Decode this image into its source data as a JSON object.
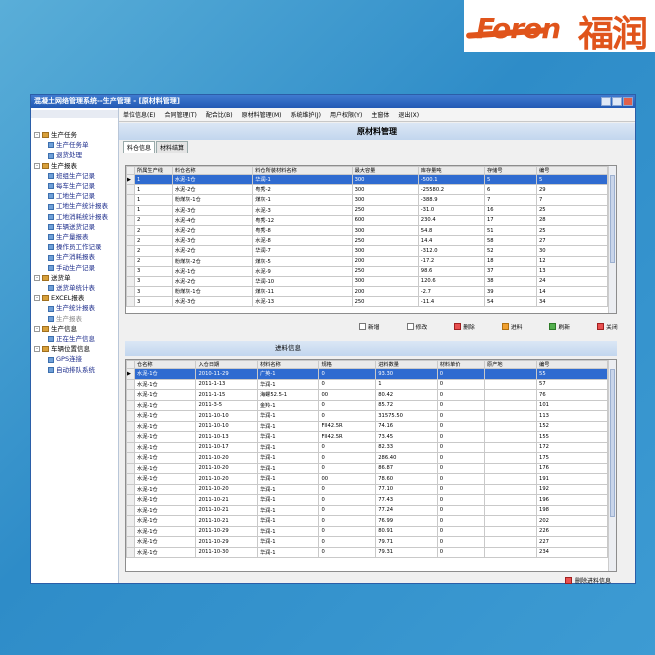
{
  "logo": {
    "en": "Foron",
    "cn": "福润"
  },
  "window": {
    "title": "混凝土网络管理系统--生产管理 - [原材料管理]"
  },
  "menu": [
    "单位信息(E)",
    "合同管理(T)",
    "配合比(B)",
    "原材料管理(M)",
    "系统维护(J)",
    "用户权限(Y)",
    "主窗体",
    "退出(X)"
  ],
  "sidebar": [
    {
      "label": "生产任务",
      "items": [
        {
          "label": "生产任务单"
        },
        {
          "label": "退货处理"
        }
      ]
    },
    {
      "label": "生产报表",
      "items": [
        {
          "label": "班组生产记录"
        },
        {
          "label": "每车生产记录"
        },
        {
          "label": "工地生产记录"
        },
        {
          "label": "工地生产统计报表"
        },
        {
          "label": "工地消耗统计报表"
        },
        {
          "label": "车辆送货记录"
        },
        {
          "label": "生产量报表"
        },
        {
          "label": "操作员工作记录"
        },
        {
          "label": "生产消耗报表"
        },
        {
          "label": "手动生产记录"
        }
      ]
    },
    {
      "label": "送货单",
      "items": [
        {
          "label": "送货单统计表"
        }
      ]
    },
    {
      "label": "EXCEL报表",
      "items": [
        {
          "label": "生产统计报表"
        },
        {
          "label": "生产报表"
        }
      ]
    },
    {
      "label": "生产信息",
      "items": [
        {
          "label": "正在生产信息"
        }
      ]
    },
    {
      "label": "车辆位置信息",
      "items": [
        {
          "label": "GPS连接"
        },
        {
          "label": "自动排队系统"
        }
      ]
    }
  ],
  "page_title": "原材料管理",
  "tabs": [
    "料仓信息",
    "材料结算"
  ],
  "bins": {
    "columns": [
      "所属生产线",
      "料仓名称",
      "料仓所装材料名称",
      "最大容量",
      "库存量吨",
      "存储号",
      "编号"
    ],
    "rows": [
      [
        "1",
        "水泥-1仓",
        "华润-1",
        "300",
        "-500.1",
        "5",
        "5"
      ],
      [
        "1",
        "水泥-2仓",
        "粤秀-2",
        "300",
        "-25580.2",
        "6",
        "29"
      ],
      [
        "1",
        "粉煤灰-1仓",
        "煤灰-1",
        "300",
        "-388.9",
        "7",
        "7"
      ],
      [
        "1",
        "水泥-3仓",
        "水泥-3",
        "250",
        "-31.0",
        "16",
        "25"
      ],
      [
        "2",
        "水泥-4仓",
        "粤秀-12",
        "600",
        "230.4",
        "17",
        "28"
      ],
      [
        "2",
        "水泥-2仓",
        "粤秀-8",
        "300",
        "54.8",
        "51",
        "25"
      ],
      [
        "2",
        "水泥-3仓",
        "水泥-8",
        "250",
        "14.4",
        "58",
        "27"
      ],
      [
        "2",
        "水泥-2仓",
        "华润-7",
        "300",
        "-312.0",
        "52",
        "30"
      ],
      [
        "2",
        "粉煤灰-2仓",
        "煤灰-5",
        "200",
        "-17.2",
        "18",
        "12"
      ],
      [
        "3",
        "水泥-1仓",
        "水泥-9",
        "250",
        "98.6",
        "37",
        "13"
      ],
      [
        "3",
        "水泥-2仓",
        "华润-10",
        "300",
        "120.6",
        "38",
        "24"
      ],
      [
        "3",
        "粉煤灰-1仓",
        "煤灰-11",
        "200",
        "-2.7",
        "39",
        "14"
      ],
      [
        "3",
        "水泥-3仓",
        "水泥-13",
        "250",
        "-11.4",
        "54",
        "34"
      ]
    ]
  },
  "toolbar": [
    "新增",
    "修改",
    "删除",
    "进料",
    "刷新",
    "关闭"
  ],
  "recv": {
    "header": "进料信息",
    "columns": [
      "仓名称",
      "入仓日期",
      "材料名称",
      "规格",
      "进料数量",
      "材料单价",
      "原产地",
      "编号"
    ],
    "rows": [
      [
        "水泥-1仓",
        "2010-11-29",
        "广英-1",
        "0",
        "93.30",
        "0",
        "",
        "55"
      ],
      [
        "水泥-1仓",
        "2011-1-13",
        "华润-1",
        "0",
        "1",
        "0",
        "",
        "57"
      ],
      [
        "水泥-1仓",
        "2011-1-15",
        "海螺52.5-1",
        "00",
        "80.42",
        "0",
        "",
        "76"
      ],
      [
        "水泥-1仓",
        "2011-3-5",
        "金羚-1",
        "0",
        "85.72",
        "0",
        "",
        "101"
      ],
      [
        "水泥-1仓",
        "2011-10-10",
        "华润-1",
        "0",
        "31575.50",
        "0",
        "",
        "113"
      ],
      [
        "水泥-1仓",
        "2011-10-10",
        "华润-1",
        "FII42.5R",
        "74.16",
        "0",
        "",
        "152"
      ],
      [
        "水泥-1仓",
        "2011-10-13",
        "华润-1",
        "FII42.5R",
        "73.45",
        "0",
        "",
        "155"
      ],
      [
        "水泥-1仓",
        "2011-10-17",
        "华润-1",
        "0",
        "82.33",
        "0",
        "",
        "172"
      ],
      [
        "水泥-1仓",
        "2011-10-20",
        "华润-1",
        "0",
        "286.40",
        "0",
        "",
        "175"
      ],
      [
        "水泥-1仓",
        "2011-10-20",
        "华润-1",
        "0",
        "86.87",
        "0",
        "",
        "176"
      ],
      [
        "水泥-1仓",
        "2011-10-20",
        "华润-1",
        "00",
        "78.60",
        "0",
        "",
        "191"
      ],
      [
        "水泥-1仓",
        "2011-10-20",
        "华润-1",
        "0",
        "77.10",
        "0",
        "",
        "192"
      ],
      [
        "水泥-1仓",
        "2011-10-21",
        "华润-1",
        "0",
        "77.43",
        "0",
        "",
        "196"
      ],
      [
        "水泥-1仓",
        "2011-10-21",
        "华润-1",
        "0",
        "77.24",
        "0",
        "",
        "198"
      ],
      [
        "水泥-1仓",
        "2011-10-21",
        "华润-1",
        "0",
        "76.99",
        "0",
        "",
        "202"
      ],
      [
        "水泥-1仓",
        "2011-10-29",
        "华润-1",
        "0",
        "80.91",
        "0",
        "",
        "226"
      ],
      [
        "水泥-1仓",
        "2011-10-29",
        "华润-1",
        "0",
        "79.71",
        "0",
        "",
        "227"
      ],
      [
        "水泥-1仓",
        "2011-10-30",
        "华润-1",
        "0",
        "79.31",
        "0",
        "",
        "234"
      ]
    ]
  },
  "delete_recv_label": "删除进料信息"
}
